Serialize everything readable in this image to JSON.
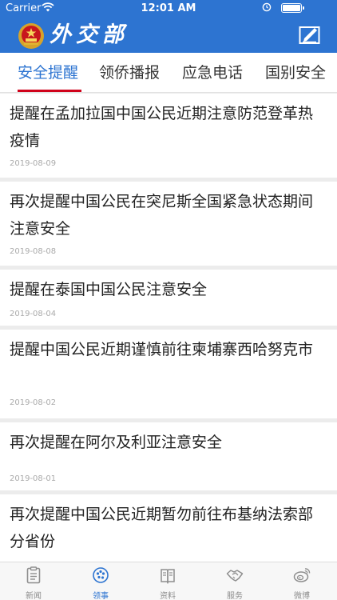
{
  "status_bar": {
    "carrier": "Carrier",
    "time": "12:01 AM"
  },
  "header": {
    "title": "外交部",
    "emblem_icon": "national-emblem-icon",
    "action_icon": "edit-icon"
  },
  "tabs": [
    {
      "label": "安全提醒",
      "active": true
    },
    {
      "label": "领侨播报",
      "active": false
    },
    {
      "label": "应急电话",
      "active": false
    },
    {
      "label": "国别安全",
      "active": false
    }
  ],
  "articles": [
    {
      "title": "提醒在孟加拉国中国公民近期注意防范登革热疫情",
      "date": "2019-08-09"
    },
    {
      "title": "再次提醒中国公民在突尼斯全国紧急状态期间注意安全",
      "date": "2019-08-08"
    },
    {
      "title": "提醒在泰国中国公民注意安全",
      "date": "2019-08-04"
    },
    {
      "title": "提醒中国公民近期谨慎前往柬埔寨西哈努克市",
      "date": "2019-08-02"
    },
    {
      "title": "再次提醒在阿尔及利亚注意安全",
      "date": "2019-08-01"
    },
    {
      "title": "再次提醒中国公民近期暂勿前往布基纳法索部分省份",
      "date": ""
    }
  ],
  "tab_bar": [
    {
      "label": "新闻",
      "icon": "news-icon",
      "active": false
    },
    {
      "label": "领事",
      "icon": "consular-icon",
      "active": true
    },
    {
      "label": "资料",
      "icon": "documents-icon",
      "active": false
    },
    {
      "label": "服务",
      "icon": "handshake-icon",
      "active": false
    },
    {
      "label": "微博",
      "icon": "weibo-icon",
      "active": false
    }
  ],
  "colors": {
    "brand_blue": "#2d74d1",
    "tab_underline": "#d0021b",
    "inactive_gray": "#8e8e8e"
  }
}
